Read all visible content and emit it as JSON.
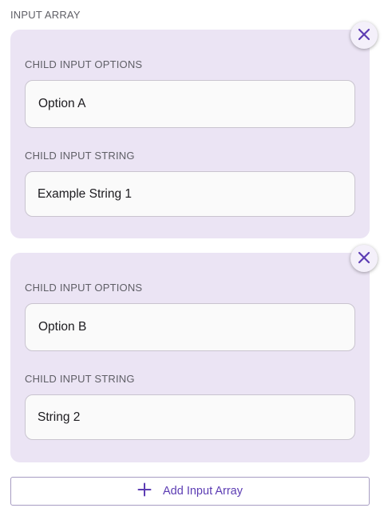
{
  "section": {
    "label": "INPUT ARRAY"
  },
  "items": [
    {
      "options_label": "CHILD INPUT OPTIONS",
      "options_value": "Option A",
      "string_label": "CHILD INPUT STRING",
      "string_value": "Example String 1",
      "remove_icon": "close-icon"
    },
    {
      "options_label": "CHILD INPUT OPTIONS",
      "options_value": "Option B",
      "string_label": "CHILD INPUT STRING",
      "string_value": "String 2",
      "remove_icon": "close-icon"
    }
  ],
  "add_button": {
    "label": "Add Input Array",
    "icon": "plus-icon"
  },
  "colors": {
    "accent": "#5c3cb3",
    "card_background": "#ebe4f4",
    "field_background": "#fafafa",
    "field_border": "#c9c4cf"
  }
}
